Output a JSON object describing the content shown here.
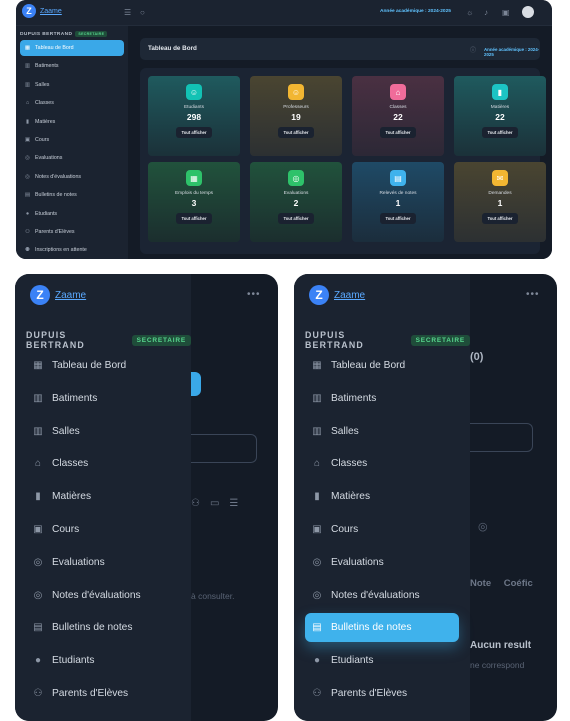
{
  "app": {
    "name": "Zaame"
  },
  "user": {
    "name": "DUPUIS BERTRAND",
    "role": "SECRETAIRE"
  },
  "topbar": {
    "academic_year": "Année académique : 2024-2025"
  },
  "sidebar": {
    "items": [
      {
        "label": "Tableau de Bord",
        "icon": "dashboard-icon"
      },
      {
        "label": "Batiments",
        "icon": "building-icon"
      },
      {
        "label": "Salles",
        "icon": "building-icon"
      },
      {
        "label": "Classes",
        "icon": "school-icon"
      },
      {
        "label": "Matières",
        "icon": "book-icon"
      },
      {
        "label": "Cours",
        "icon": "presentation-icon"
      },
      {
        "label": "Evaluations",
        "icon": "clipboard-icon"
      },
      {
        "label": "Notes d'évaluations",
        "icon": "clipboard-icon"
      },
      {
        "label": "Bulletins de notes",
        "icon": "report-icon"
      },
      {
        "label": "Etudiants",
        "icon": "users-icon"
      },
      {
        "label": "Parents d'Elèves",
        "icon": "parent-icon"
      },
      {
        "label": "Inscriptions en attente",
        "icon": "user-clock-icon"
      }
    ]
  },
  "dashboard": {
    "title": "Tableau de Bord",
    "academic_year": "Année académique : 2024-2025",
    "cards": [
      {
        "label": "Etudiants",
        "value": "298",
        "button": "Tout afficher",
        "color": "#12c2b4",
        "icon": "users-icon"
      },
      {
        "label": "Professeurs",
        "value": "19",
        "button": "Tout afficher",
        "color": "#f2b632",
        "icon": "teacher-icon"
      },
      {
        "label": "Classes",
        "value": "22",
        "button": "Tout afficher",
        "color": "#f06c9a",
        "icon": "school-icon"
      },
      {
        "label": "Matières",
        "value": "22",
        "button": "Tout afficher",
        "color": "#1cc4c4",
        "icon": "book-icon"
      },
      {
        "label": "Emplois du temps",
        "value": "3",
        "button": "Tout afficher",
        "color": "#2ec26a",
        "icon": "calendar-icon"
      },
      {
        "label": "Evaluations",
        "value": "2",
        "button": "Tout afficher",
        "color": "#2ec26a",
        "icon": "clipboard-icon"
      },
      {
        "label": "Relevés de notes",
        "value": "1",
        "button": "Tout afficher",
        "color": "#3fb2ec",
        "icon": "report-icon"
      },
      {
        "label": "Demandes",
        "value": "1",
        "button": "Tout afficher",
        "color": "#f2b632",
        "icon": "request-icon"
      }
    ]
  },
  "peek_left": {
    "text": "à consulter."
  },
  "peek_right": {
    "count": "(0)",
    "col_note": "Note",
    "col_coef": "Coéfic",
    "result": "Aucun result",
    "sub": "ne correspond"
  }
}
